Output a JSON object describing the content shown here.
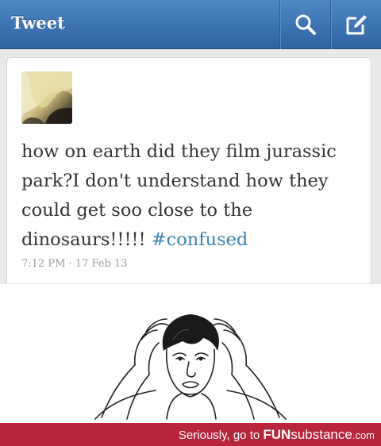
{
  "topbar": {
    "title": "Tweet",
    "search_icon": "search-icon",
    "compose_icon": "compose-icon"
  },
  "tweet": {
    "text": "how on earth did they film jurassic park?I don't understand how they could get soo close to the dinosaurs!!!!! ",
    "hashtag": "#confused",
    "time": "7:12 PM",
    "separator": " · ",
    "date": "17 Feb 13",
    "colors": {
      "hashtag": "#3b85b5",
      "text": "#333333"
    }
  },
  "footer": {
    "prefix": "Seriously, go to ",
    "brand_fun": "FUN",
    "brand_rest": "substance",
    "brand_com": ".com",
    "color": "#b8243a"
  }
}
